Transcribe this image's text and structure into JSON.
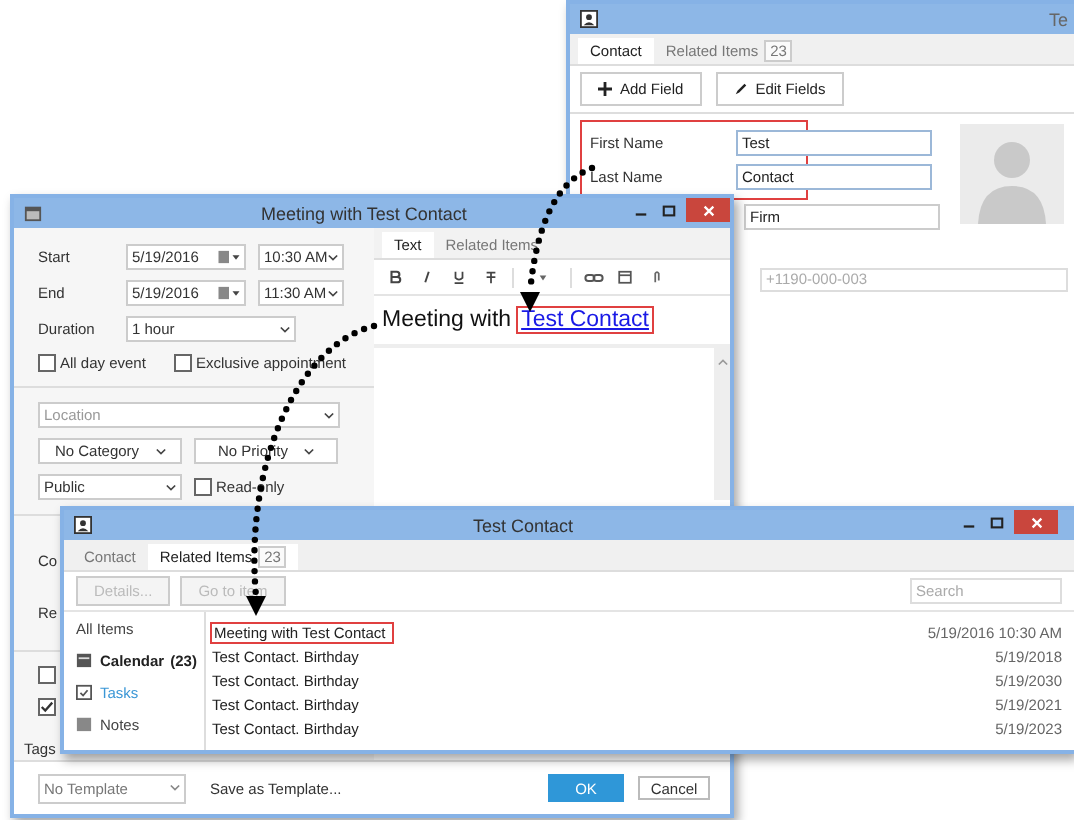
{
  "contact_window": {
    "title": "Te",
    "tabs": [
      {
        "label": "Contact",
        "selected": true
      },
      {
        "label": "Related Items",
        "count": "23",
        "selected": false
      }
    ],
    "buttons": [
      {
        "label": "Add Field"
      },
      {
        "label": "Edit Fields"
      }
    ],
    "name_fields": {
      "highlighted": true,
      "rows": [
        {
          "label": "First Name",
          "value": "Test"
        },
        {
          "label": "Last Name",
          "value": "Contact"
        }
      ]
    },
    "firm_field": {
      "value": "Firm"
    },
    "phone_field": {
      "placeholder": "+1190-000-003"
    }
  },
  "meeting_window": {
    "title": "Meeting with Test Contact",
    "start": {
      "label": "Start",
      "date": "5/19/2016",
      "time": "10:30 AM"
    },
    "end": {
      "label": "End",
      "date": "5/19/2016",
      "time": "11:30 AM"
    },
    "duration": {
      "label": "Duration",
      "value": "1 hour"
    },
    "all_day": {
      "label": "All day event",
      "checked": false
    },
    "exclusive": {
      "label": "Exclusive appointment",
      "checked": false
    },
    "location": {
      "placeholder": "Location"
    },
    "category": "No Category",
    "priority": "No Priority",
    "visibility": "Public",
    "read_only": {
      "label": "Read-only",
      "checked": false
    },
    "cut_labels": [
      "Co",
      "Re"
    ],
    "options": [
      {
        "checked": false
      },
      {
        "checked": true
      }
    ],
    "tags_label": "Tags",
    "tabs": [
      {
        "label": "Text",
        "selected": true
      },
      {
        "label": "Related Items",
        "selected": false
      }
    ],
    "body": {
      "text": "Meeting with",
      "link": "Test Contact",
      "highlighted": true
    },
    "template": "No Template",
    "save_template": "Save as Template...",
    "ok": "OK",
    "cancel": "Cancel"
  },
  "related_window": {
    "title": "Test Contact",
    "tabs": [
      {
        "label": "Contact",
        "selected": false
      },
      {
        "label": "Related Items",
        "count": "23",
        "selected": true
      }
    ],
    "buttons": [
      {
        "label": "Details...",
        "disabled": true
      },
      {
        "label": "Go to item",
        "disabled": true
      }
    ],
    "search": {
      "placeholder": "Search"
    },
    "sidebar": [
      {
        "label": "All Items",
        "selected": false,
        "hovered": false
      },
      {
        "label": "Calendar",
        "count": "(23)",
        "selected": true,
        "hovered": false
      },
      {
        "label": "Tasks",
        "selected": false,
        "hovered": true
      },
      {
        "label": "Notes",
        "selected": false,
        "hovered": false
      }
    ],
    "rows": [
      {
        "title": "Meeting with Test Contact",
        "date": "5/19/2016 10:30 AM",
        "highlighted": true
      },
      {
        "title": "Test Contact. Birthday",
        "date": "5/19/2018",
        "highlighted": false
      },
      {
        "title": "Test Contact. Birthday",
        "date": "5/19/2030",
        "highlighted": false
      },
      {
        "title": "Test Contact. Birthday",
        "date": "5/19/2021",
        "highlighted": false
      },
      {
        "title": "Test Contact. Birthday",
        "date": "5/19/2023",
        "highlighted": false
      }
    ]
  }
}
